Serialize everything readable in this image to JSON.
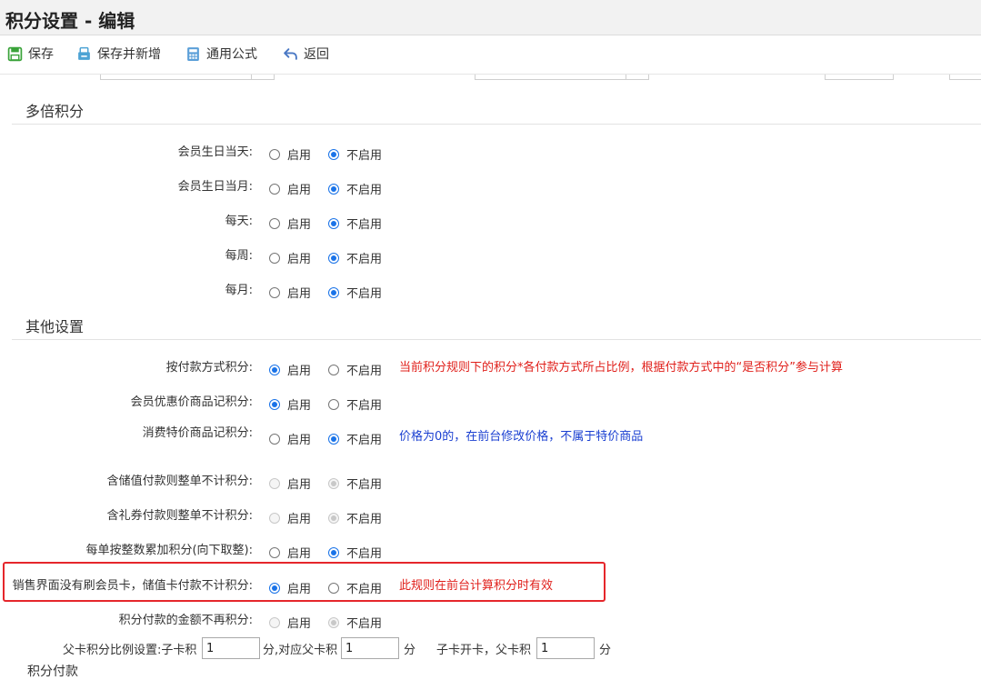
{
  "title": "积分设置 - 编辑",
  "toolbar": {
    "save": "保存",
    "save_new": "保存并新增",
    "formula": "通用公式",
    "back": "返回"
  },
  "options": {
    "on": "启用",
    "off": "不启用"
  },
  "sections": {
    "multi": "多倍积分",
    "other": "其他设置"
  },
  "multi_rows": [
    {
      "label": "会员生日当天:",
      "selected": "off"
    },
    {
      "label": "会员生日当月:",
      "selected": "off"
    },
    {
      "label": "每天:",
      "selected": "off"
    },
    {
      "label": "每周:",
      "selected": "off"
    },
    {
      "label": "每月:",
      "selected": "off"
    }
  ],
  "other_rows": [
    {
      "label": "按付款方式积分:",
      "selected": "on",
      "note": "当前积分规则下的积分*各付款方式所占比例，根据付款方式中的“是否积分”参与计算"
    },
    {
      "label": "会员优惠价商品记积分:",
      "selected": "on"
    },
    {
      "label": "消费特价商品记积分:",
      "selected": "off",
      "note": "价格为0的，在前台修改价格，不属于特价商品"
    },
    {
      "label": "含储值付款则整单不计积分:",
      "selected": "off",
      "disabled": true
    },
    {
      "label": "含礼券付款则整单不计积分:",
      "selected": "off",
      "disabled": true
    },
    {
      "label": "每单按整数累加积分(向下取整):",
      "selected": "off"
    },
    {
      "label": "销售界面没有刷会员卡，储值卡付款不计积分:",
      "selected": "on",
      "note": "此规则在前台计算积分时有效"
    },
    {
      "label": "积分付款的金额不再积分:",
      "selected": "off",
      "disabled": true
    }
  ],
  "ratio": {
    "label": "父卡积分比例设置:子卡积",
    "child_value": "1",
    "mid": "分,对应父卡积",
    "parent_value": "1",
    "unit": "分",
    "open_label": "子卡开卡，父卡积",
    "open_value": "1",
    "unit2": "分"
  },
  "cutoff": "积分付款",
  "colors": {
    "accent": "#1a73e8",
    "note_red": "#e0201b",
    "note_blue": "#1a3fd1",
    "highlight": "#e5262b"
  }
}
